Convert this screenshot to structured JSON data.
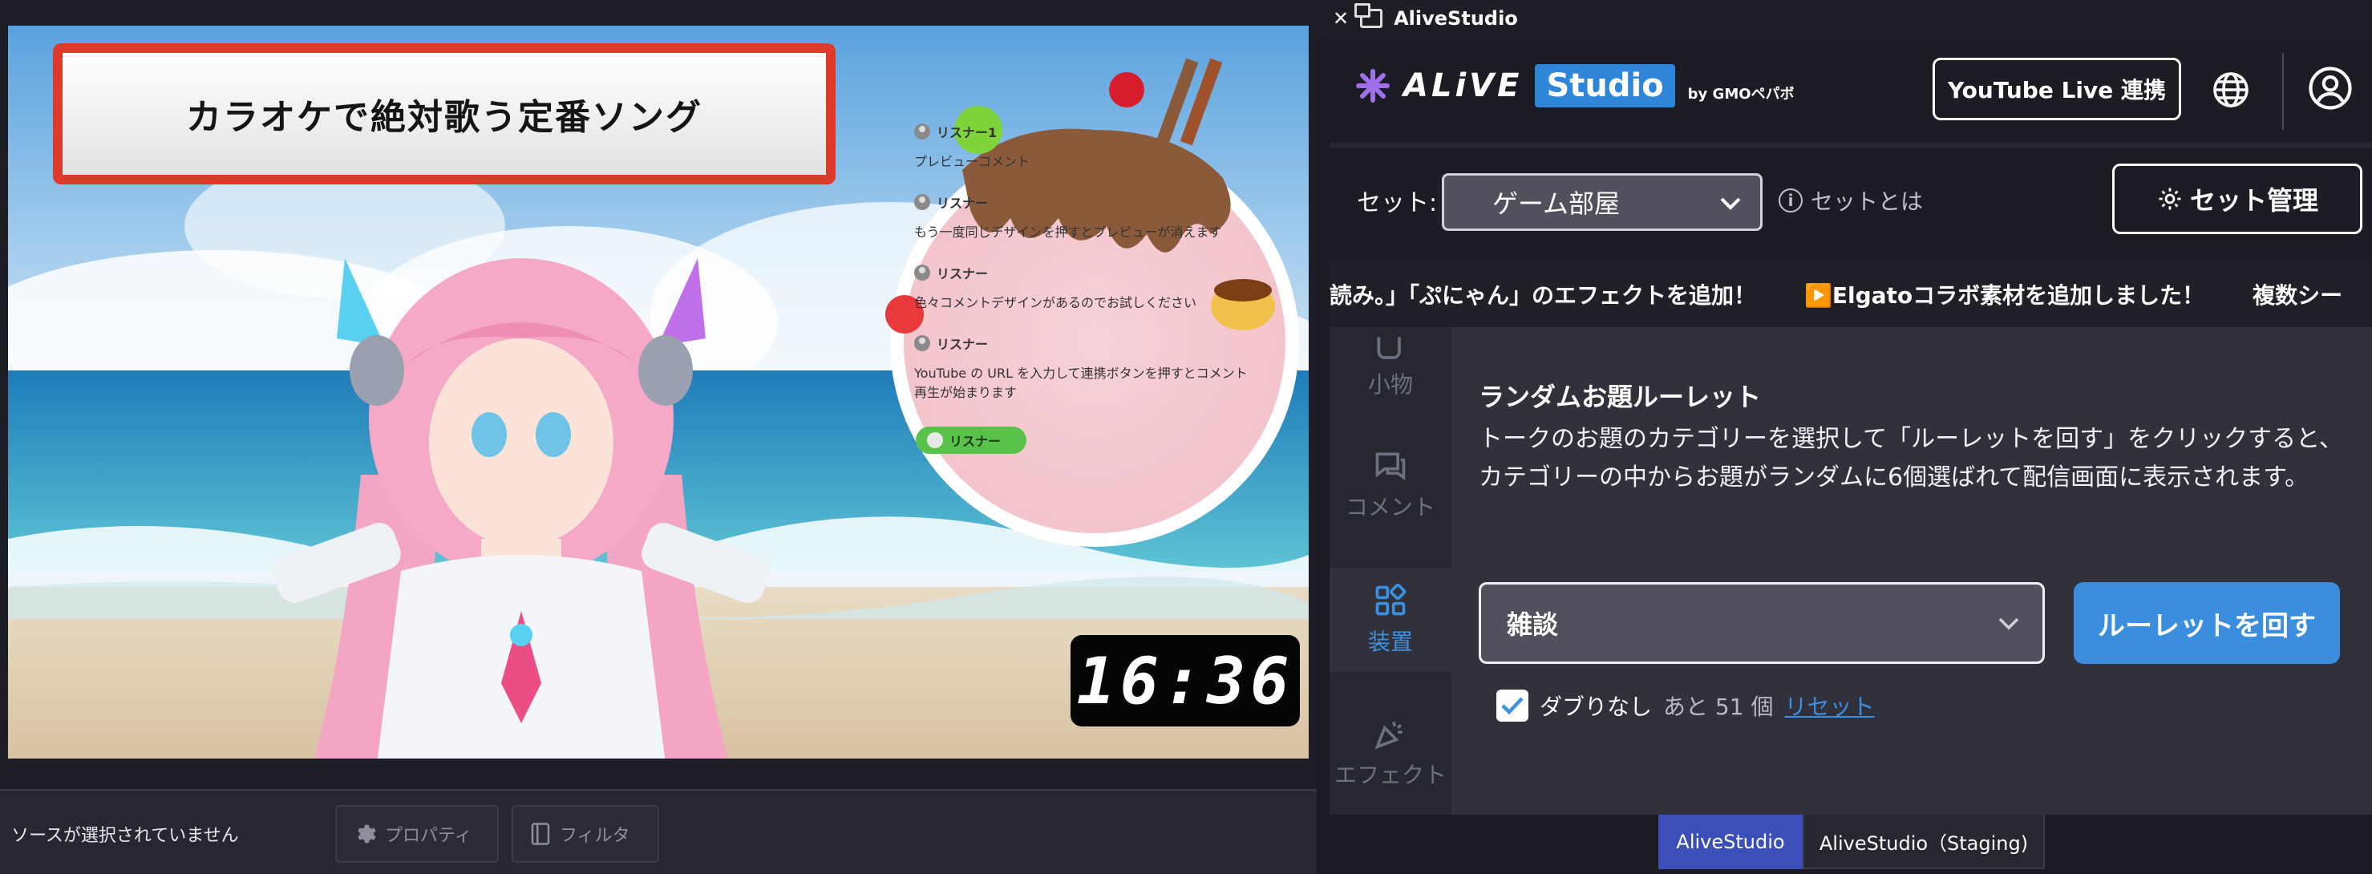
{
  "obs": {
    "title_banner": "カラオケで絶対歌う定番ソング",
    "comments": [
      {
        "user": "リスナー1",
        "text": "プレビューコメント"
      },
      {
        "user": "リスナー",
        "text": "もう一度同じデザインを押すとプレビューが消えます"
      },
      {
        "user": "リスナー",
        "text": "色々コメントデザインがあるのでお試しください"
      },
      {
        "user": "リスナー",
        "text": "YouTube の URL を入力して連携ボタンを押すとコメント再生が始まります"
      }
    ],
    "listener_pill": "リスナー",
    "clock": "16:36",
    "no_source": "ソースが選択されていません",
    "properties_label": "プロパティ",
    "filter_label": "フィルタ"
  },
  "dock": {
    "window_title": "AliveStudio",
    "logo": {
      "alive": "ALiVE",
      "studio": "Studio",
      "by": "by GMOペパボ"
    },
    "youtube_button": "YouTube Live 連携",
    "set_label": "セット:",
    "set_value": "ゲーム部屋",
    "set_help": "セットとは",
    "set_manage": "セット管理",
    "ticker": [
      "読み。」「ぷにゃん」のエフェクトを追加！",
      "▶️Elgatoコラボ素材を追加しました！",
      "複数シー"
    ],
    "sidebar": [
      {
        "label": "小物",
        "icon": "cup-icon",
        "active": false
      },
      {
        "label": "コメント",
        "icon": "comment-icon",
        "active": false
      },
      {
        "label": "装置",
        "icon": "widgets-icon",
        "active": true
      },
      {
        "label": "エフェクト",
        "icon": "party-popper-icon",
        "active": false
      }
    ],
    "roulette": {
      "title": "ランダムお題ルーレット",
      "description": "トークのお題のカテゴリーを選択して「ルーレットを回す」をクリックすると、カテゴリーの中からお題がランダムに6個選ばれて配信画面に表示されます。",
      "category": "雑談",
      "spin_button": "ルーレットを回す",
      "no_duplicate_label": "ダブりなし",
      "no_duplicate_checked": true,
      "remaining": "あと 51 個",
      "reset": "リセット"
    }
  },
  "tabs": [
    {
      "label": "AliveStudio",
      "active": true
    },
    {
      "label": "AliveStudio（Staging)",
      "active": false
    }
  ],
  "colors": {
    "accent": "#3b8edd",
    "banner_border": "#dd3a2b",
    "active_tab": "#3a50b8"
  }
}
